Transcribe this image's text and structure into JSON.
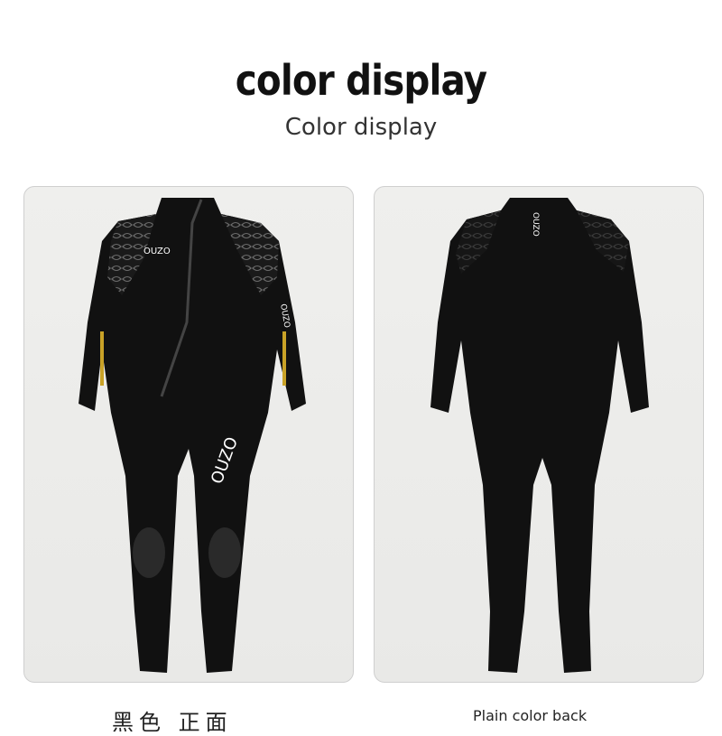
{
  "heading": {
    "title": "color display",
    "subtitle": "Color display"
  },
  "products": [
    {
      "view": "front",
      "caption": "黑色 正面",
      "brand_chest": "OUZO",
      "brand_leg": "OUZO",
      "brand_arm": "OUZO",
      "suit_color": "#111111",
      "accent_color": "#c9a227"
    },
    {
      "view": "back",
      "caption": "Plain color back",
      "brand_chest": "OUZO",
      "suit_color": "#111111"
    }
  ]
}
